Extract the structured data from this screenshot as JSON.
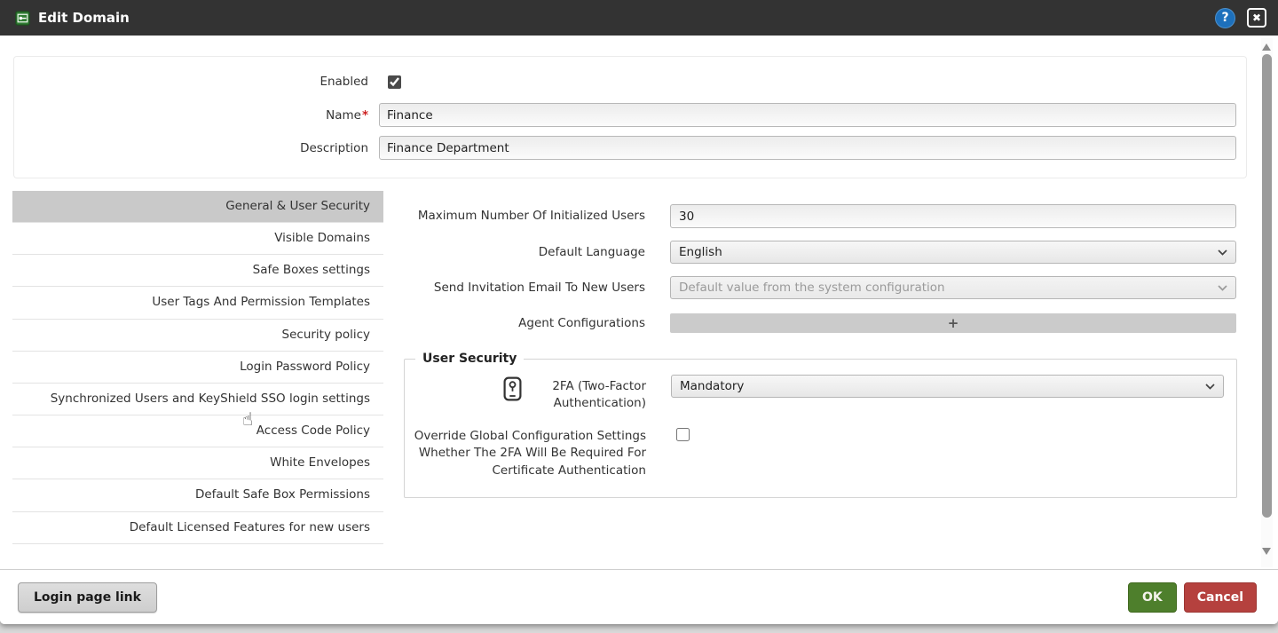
{
  "titlebar": {
    "title": "Edit Domain",
    "help_glyph": "?",
    "close_glyph": "✖"
  },
  "general": {
    "enabled_label": "Enabled",
    "enabled_checked": true,
    "name_label": "Name",
    "required_marker": "*",
    "name_value": "Finance",
    "description_label": "Description",
    "description_value": "Finance Department"
  },
  "sidebar": {
    "items": [
      {
        "label": "General & User Security",
        "selected": true
      },
      {
        "label": "Visible Domains",
        "selected": false
      },
      {
        "label": "Safe Boxes settings",
        "selected": false
      },
      {
        "label": "User Tags And Permission Templates",
        "selected": false
      },
      {
        "label": "Security policy",
        "selected": false
      },
      {
        "label": "Login Password Policy",
        "selected": false
      },
      {
        "label": "Synchronized Users and KeyShield SSO login settings",
        "selected": false
      },
      {
        "label": "Access Code Policy",
        "selected": false
      },
      {
        "label": "White Envelopes",
        "selected": false
      },
      {
        "label": "Default Safe Box Permissions",
        "selected": false
      },
      {
        "label": "Default Licensed Features for new users",
        "selected": false
      }
    ],
    "cursor_glyph": "☝"
  },
  "form": {
    "max_users_label": "Maximum Number Of Initialized Users",
    "max_users_value": "30",
    "default_language_label": "Default Language",
    "default_language_value": "English",
    "invitation_label": "Send Invitation Email To New Users",
    "invitation_value": "Default value from the system configuration",
    "agent_config_label": "Agent Configurations",
    "agent_config_add_glyph": "+",
    "user_security": {
      "legend": "User Security",
      "tfa_label": "2FA (Two-Factor Authentication)",
      "tfa_value": "Mandatory",
      "override_label": "Override Global Configuration Settings Whether The 2FA Will Be Required For Certificate Authentication",
      "override_checked": false
    }
  },
  "footer": {
    "login_page_link_label": "Login page link",
    "ok_label": "OK",
    "cancel_label": "Cancel"
  },
  "colors": {
    "titlebar_bg": "#333333",
    "help_blue": "#1d70bc",
    "app_icon_green": "#2f7d32",
    "selected_item_bg": "#c9c9c9",
    "ok_green": "#4e7f2c",
    "cancel_red": "#b5413e",
    "required_red": "#cc2020"
  }
}
